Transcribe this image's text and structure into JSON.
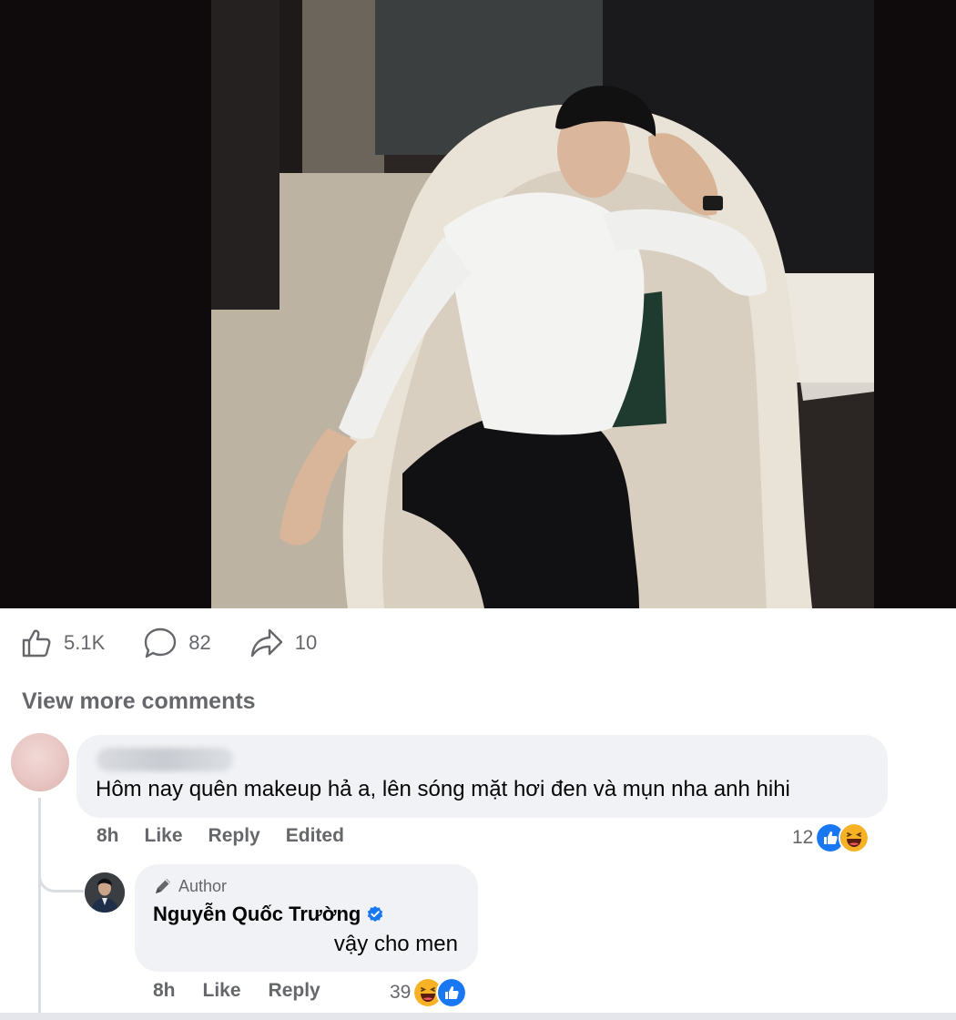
{
  "post": {
    "stats": {
      "likes": "5.1K",
      "comments": "82",
      "shares": "10"
    },
    "view_more_comments": "View more comments"
  },
  "comments": [
    {
      "author": "",
      "text": "Hôm nay quên makeup hả a, lên sóng mặt hơi đen và mụn nha anh hihi",
      "time": "8h",
      "like_label": "Like",
      "reply_label": "Reply",
      "edited_label": "Edited",
      "reaction_count": "12",
      "reactions": [
        "like-icon",
        "haha-icon"
      ]
    }
  ],
  "reply": {
    "badge": "Author",
    "author": "Nguyễn Quốc Trường",
    "verified": true,
    "text": "vậy cho men",
    "time": "8h",
    "like_label": "Like",
    "reply_label": "Reply",
    "reaction_count": "39",
    "reactions": [
      "haha-icon",
      "like-icon"
    ]
  },
  "colors": {
    "like_blue": "#1877f2",
    "haha_yellow": "#f7b125",
    "bubble_bg": "#f0f2f5",
    "secondary_text": "#65676b"
  }
}
